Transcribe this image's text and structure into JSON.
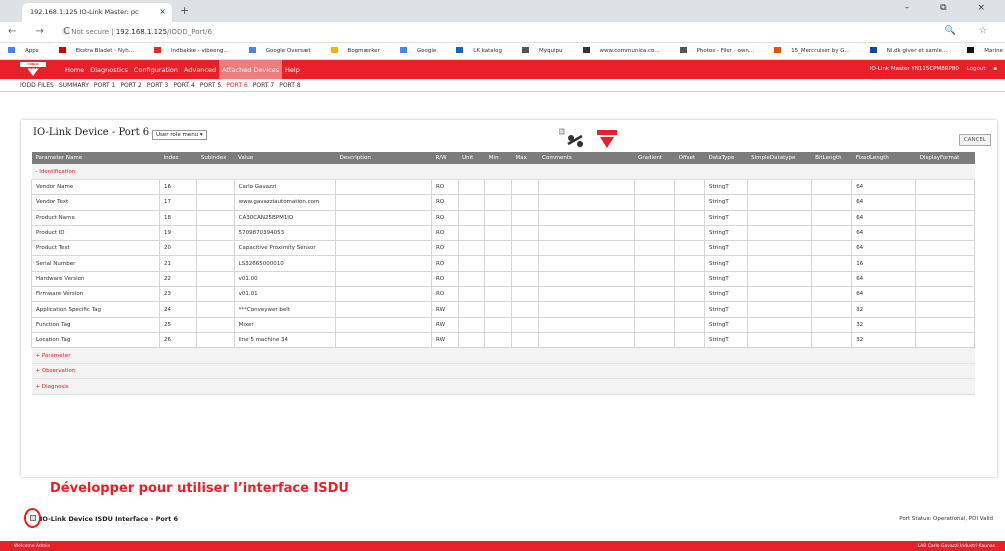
{
  "browser": {
    "tab_title": "192.168.1.125 IO-Link Master: pc",
    "tab_close": "×",
    "new_tab": "+",
    "win_controls": "–  ⧉  ×",
    "nav": "← → C",
    "secure": "ⓘ Not secure |",
    "url_host": "192.168.1.125",
    "url_path": "/IODD_Port/6",
    "addr_right": "🔍 ☆",
    "bookmarks": [
      "Apps",
      "Ekstra Bladet - Nyh...",
      "Indbakke - vibeeng...",
      "Google Oversæt",
      "Bogmærker",
      "Google",
      "LK katalog",
      "Myquipu",
      "www.communica.co...",
      "Photos - Filer - own...",
      "15_Mercruiser by G...",
      "Ni.dk giver et samle...",
      "Marine Louver Vents"
    ],
    "bookmark_colors": [
      "#4285f4",
      "#cc0000",
      "#d93025",
      "#4285f4",
      "#f4b400",
      "#4285f4",
      "#1565c0",
      "#555555",
      "#333333",
      "#555555",
      "#e65100",
      "#0d47a1",
      "#111111"
    ]
  },
  "app": {
    "logo_text": "CARLO GAVAZZI",
    "menu": [
      "Home",
      "Diagnostics",
      "Configuration",
      "Advanced",
      "Attached Devices",
      "Help"
    ],
    "active_menu": "Attached Devices",
    "master_title": "IO-Link Master YN115CPM8RP80",
    "logout": "Logout",
    "submenu": [
      "IODD FILES",
      "SUMMARY",
      "PORT 1",
      "PORT 2",
      "PORT 3",
      "PORT 4",
      "PORT 5",
      "PORT 6",
      "PORT 7",
      "PORT 8"
    ],
    "active_submenu": "PORT 6"
  },
  "device": {
    "title": "IO-Link Device - Port 6",
    "role_menu": "User role menu ▾",
    "cancel": "CANCEL",
    "columns": [
      "Parameter Name",
      "Index",
      "Subindex",
      "Value",
      "Description",
      "R/W",
      "Unit",
      "Min",
      "Max",
      "Comments",
      "Gradient",
      "Offset",
      "DataType",
      "SimpleDatatype",
      "BitLength",
      "FixedLength",
      "DisplayFormat"
    ],
    "section_open": "- Identification",
    "rows": [
      {
        "name": "Vendor Name",
        "index": "16",
        "value": "Carlo Gavazzi",
        "rw": "RO",
        "type": "StringT",
        "len": "64"
      },
      {
        "name": "Vendor Text",
        "index": "17",
        "value": "www.gavazziautomation.com",
        "rw": "RO",
        "type": "StringT",
        "len": "64"
      },
      {
        "name": "Product Name",
        "index": "18",
        "value": "CA30CAN25BPM1IO",
        "rw": "RO",
        "type": "StringT",
        "len": "64"
      },
      {
        "name": "Product ID",
        "index": "19",
        "value": "5709870394053",
        "rw": "RO",
        "type": "StringT",
        "len": "64"
      },
      {
        "name": "Product Text",
        "index": "20",
        "value": "Capacitive Proximity Sensor",
        "rw": "RO",
        "type": "StringT",
        "len": "64"
      },
      {
        "name": "Serial Number",
        "index": "21",
        "value": "LS32665000010",
        "rw": "RO",
        "type": "StringT",
        "len": "16"
      },
      {
        "name": "Hardware Version",
        "index": "22",
        "value": "v01.00",
        "rw": "RO",
        "type": "StringT",
        "len": "64"
      },
      {
        "name": "Firmware Version",
        "index": "23",
        "value": "v01.01",
        "rw": "RO",
        "type": "StringT",
        "len": "64"
      },
      {
        "name": "Application Specific Tag",
        "index": "24",
        "value": "***Conveywer belt",
        "rw": "RW",
        "type": "StringT",
        "len": "32"
      },
      {
        "name": "Function Tag",
        "index": "25",
        "value": "Mixer",
        "rw": "RW",
        "type": "StringT",
        "len": "32"
      },
      {
        "name": "Location Tag",
        "index": "26",
        "value": "line 5 machine 34",
        "rw": "RW",
        "type": "StringT",
        "len": "32"
      }
    ],
    "collapsed_sections": [
      "+ Parameter",
      "+ Observation",
      "+ Diagnosis"
    ]
  },
  "annotation": "Développer pour utiliser l’interface ISDU",
  "isdu": {
    "title": "IO-Link Device ISDU Interface - Port 6",
    "port_status": "Port Status: Operational, PDI Valid"
  },
  "footer": {
    "left": "Welcome Admin",
    "right": "LAB Carlo Gavazzi Industri Kaunas"
  }
}
